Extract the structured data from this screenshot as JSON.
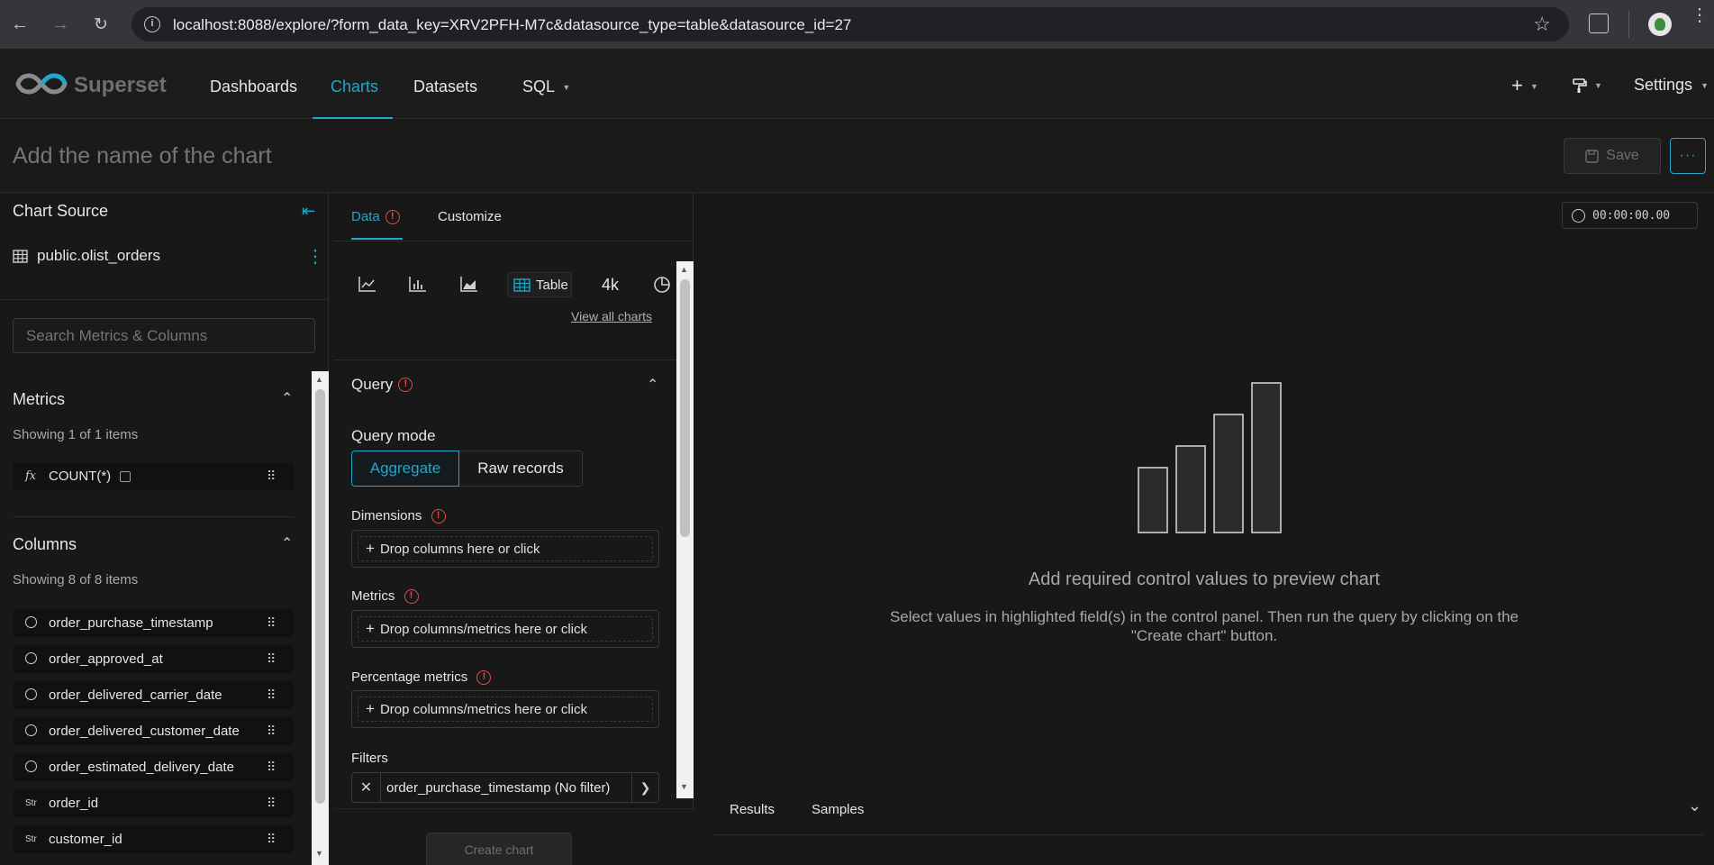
{
  "browser": {
    "url": "localhost:8088/explore/?form_data_key=XRV2PFH-M7c&datasource_type=table&datasource_id=27"
  },
  "nav": {
    "logo": "Superset",
    "items": [
      "Dashboards",
      "Charts",
      "Datasets",
      "SQL"
    ],
    "active": "Charts",
    "settings": "Settings"
  },
  "title_bar": {
    "chart_name_placeholder": "Add the name of the chart",
    "save_label": "Save"
  },
  "datasource": {
    "section_title": "Chart Source",
    "name": "public.olist_orders",
    "search_placeholder": "Search Metrics & Columns",
    "metrics_title": "Metrics",
    "metrics_showing": "Showing 1 of 1 items",
    "metrics": [
      {
        "type": "fx",
        "name": "COUNT(*)"
      }
    ],
    "columns_title": "Columns",
    "columns_showing": "Showing 8 of 8 items",
    "columns": [
      {
        "type": "time",
        "name": "order_purchase_timestamp"
      },
      {
        "type": "time",
        "name": "order_approved_at"
      },
      {
        "type": "time",
        "name": "order_delivered_carrier_date"
      },
      {
        "type": "time",
        "name": "order_delivered_customer_date"
      },
      {
        "type": "time",
        "name": "order_estimated_delivery_date"
      },
      {
        "type": "Str",
        "name": "order_id"
      },
      {
        "type": "Str",
        "name": "customer_id"
      }
    ]
  },
  "controls": {
    "tabs": [
      "Data",
      "Customize"
    ],
    "active_tab": "Data",
    "viz_types": [
      {
        "icon": "line-chart-icon",
        "label": ""
      },
      {
        "icon": "bar-chart-icon",
        "label": ""
      },
      {
        "icon": "area-chart-icon",
        "label": ""
      },
      {
        "icon": "table-icon",
        "label": "Table"
      },
      {
        "icon": "big-number-icon",
        "label": "4k"
      },
      {
        "icon": "pie-chart-icon",
        "label": ""
      }
    ],
    "view_all": "View all charts",
    "query_section": "Query",
    "query_mode_label": "Query mode",
    "query_modes": [
      "Aggregate",
      "Raw records"
    ],
    "active_query_mode": "Aggregate",
    "dimensions_label": "Dimensions",
    "dimensions_placeholder": "Drop columns here or click",
    "metrics_label": "Metrics",
    "metrics_placeholder": "Drop columns/metrics here or click",
    "percentage_metrics_label": "Percentage metrics",
    "percentage_metrics_placeholder": "Drop columns/metrics here or click",
    "filters_label": "Filters",
    "filter_value": "order_purchase_timestamp (No filter)",
    "create_chart": "Create chart"
  },
  "chart_area": {
    "timer": "00:00:00.00",
    "empty_title": "Add required control values to preview chart",
    "empty_desc_line1": "Select values in highlighted field(s) in the control panel. Then run the query by clicking on the",
    "empty_desc_line2": "\"Create chart\" button.",
    "bottom_tabs": [
      "Results",
      "Samples"
    ]
  },
  "colors": {
    "accent": "#20a7c9",
    "error": "#e04c4c",
    "background": "#181818"
  }
}
